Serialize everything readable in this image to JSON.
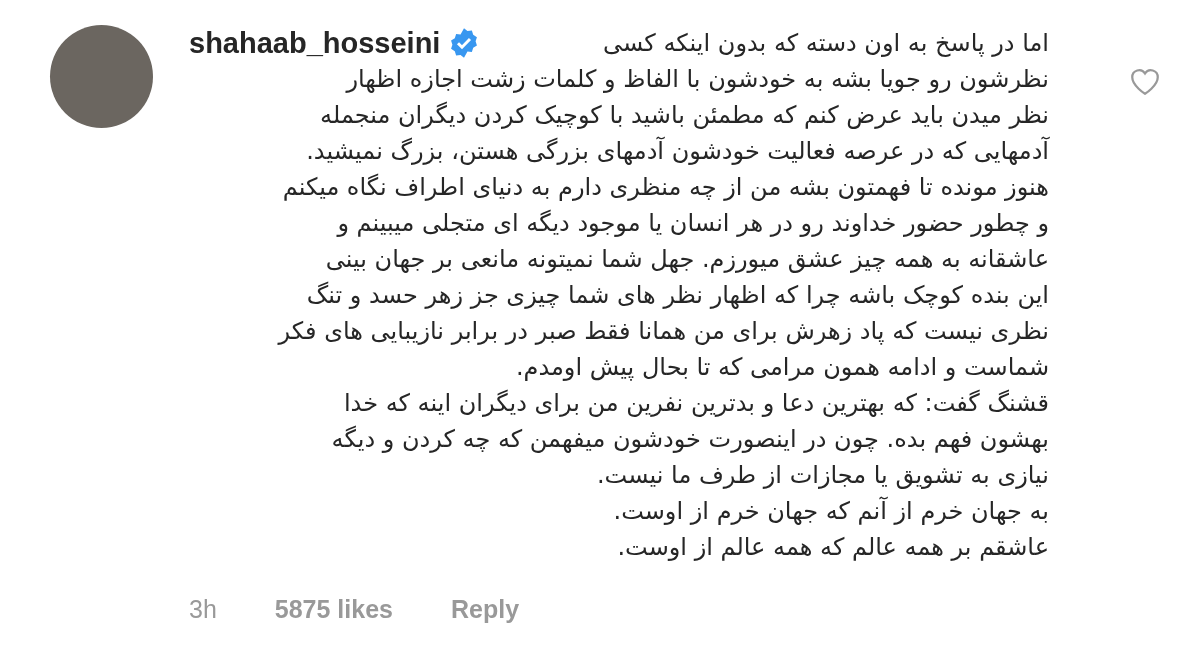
{
  "comment": {
    "username": "shahaab_hosseini",
    "verified": true,
    "lines": [
      "اما در پاسخ به اون دسته که بدون اینکه کسی",
      "نظرشون رو جویا بشه به خودشون با الفاظ و کلمات زشت اجازه اظهار",
      "نظر میدن باید عرض کنم که مطمئن باشید با کوچیک کردن دیگران منجمله",
      "آدمهایی که در عرصه فعالیت خودشون آدمهای بزرگی هستن، بزرگ نمیشید.",
      "هنوز مونده تا فهمتون بشه من از چه منظری دارم به دنیای اطراف نگاه میکنم",
      "و چطور حضور خداوند رو در هر انسان یا موجود دیگه ای متجلی میبینم و",
      "عاشقانه به همه چیز عشق میورزم. جهل شما نمیتونه مانعی بر جهان بینی",
      "این بنده کوچک باشه چرا که اظهار نظر های شما چیزی جز زهر حسد و تنگ",
      "نظری نیست که پاد زهرش برای من همانا فقط صبر در برابر نازیبایی های فکر",
      "شماست و ادامه همون مرامی که تا بحال پیش اومدم.",
      "قشنگ گفت: که بهترین دعا و بدترین نفرین من برای دیگران اینه که خدا",
      "بهشون فهم بده. چون در اینصورت خودشون میفهمن که چه کردن و دیگه",
      "نیازی به تشویق یا مجازات از طرف ما نیست.",
      "به جهان خرم از آنم که جهان خرم از اوست.",
      "عاشقم بر همه عالم که همه عالم از اوست."
    ]
  },
  "liked": false,
  "footer": {
    "time": "3h",
    "likes": "5875 likes",
    "reply": "Reply"
  }
}
